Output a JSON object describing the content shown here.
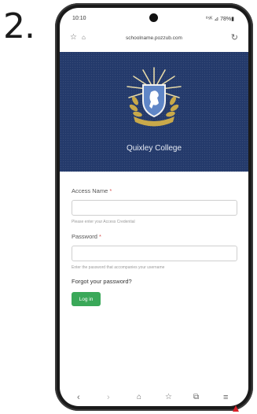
{
  "step": {
    "number": "2."
  },
  "status_bar": {
    "time": "10:10",
    "icons": "⁰⁵ᴷ ⊿ 78%▮"
  },
  "browser": {
    "url": "schoolname.pozzub.com",
    "icons": {
      "bookmark": "star-outline-icon",
      "lock": "lock-icon",
      "reload": "reload-icon"
    }
  },
  "header": {
    "college_name": "Quixley College",
    "background_color": "#243a6b"
  },
  "form": {
    "access_name_label": "Access Name",
    "access_name_required": " *",
    "access_name_value": "",
    "access_name_hint": "Please enter your Access Credential",
    "password_label": "Password",
    "password_required": " *",
    "password_value": "",
    "password_hint": "Enter the password that accompanies your username",
    "forgot_link": "Forgot your password?",
    "login_button": "Log in",
    "login_button_color": "#3aa859"
  },
  "bottom_nav": {
    "back": "‹",
    "forward": "›",
    "home": "⌂",
    "bookmarks": "☆",
    "tabs": "⧉",
    "menu": "≡"
  }
}
